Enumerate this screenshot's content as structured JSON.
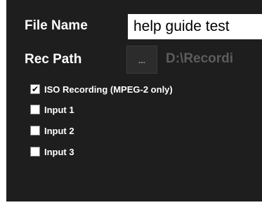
{
  "file_name": {
    "label": "File Name",
    "value": "help guide test"
  },
  "rec_path": {
    "label": "Rec Path",
    "browse_label": "...",
    "value": "D:\\Recordi"
  },
  "checkboxes": [
    {
      "label": "ISO Recording (MPEG-2 only)",
      "checked": true,
      "mark": "✔"
    },
    {
      "label": "Input 1",
      "checked": false,
      "mark": ""
    },
    {
      "label": "Input 2",
      "checked": false,
      "mark": ""
    },
    {
      "label": "Input 3",
      "checked": false,
      "mark": ""
    }
  ],
  "colors": {
    "panel_background": "#1e1e1e",
    "label_text": "#ffffff",
    "path_text": "#5c5c5c"
  }
}
